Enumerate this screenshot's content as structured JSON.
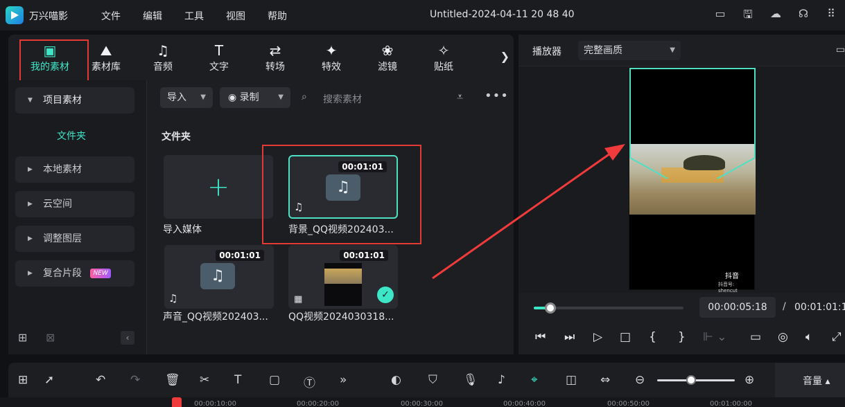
{
  "app": {
    "name": "万兴喵影",
    "doc_title": "Untitled-2024-04-11 20 48 40"
  },
  "menu": [
    "文件",
    "编辑",
    "工具",
    "视图",
    "帮助"
  ],
  "tabs": [
    {
      "label": "我的素材",
      "icon": "image-icon"
    },
    {
      "label": "素材库",
      "icon": "cloud-image-icon"
    },
    {
      "label": "音频",
      "icon": "music-note-icon"
    },
    {
      "label": "文字",
      "icon": "text-icon"
    },
    {
      "label": "转场",
      "icon": "transition-icon"
    },
    {
      "label": "特效",
      "icon": "sparkle-icon"
    },
    {
      "label": "滤镜",
      "icon": "filter-icon"
    },
    {
      "label": "贴纸",
      "icon": "sticker-icon"
    }
  ],
  "sidebar": {
    "project": "项目素材",
    "folder": "文件夹",
    "items": [
      "本地素材",
      "云空间",
      "调整图层",
      "复合片段"
    ],
    "new_badge": "NEW"
  },
  "toolbar": {
    "import": "导入",
    "record": "录制",
    "search_placeholder": "搜索素材"
  },
  "content": {
    "folder_title": "文件夹",
    "import_media": "导入媒体",
    "media": [
      {
        "label": "背景_QQ视频202403...",
        "duration": "00:01:01",
        "type": "audio"
      },
      {
        "label": "声音_QQ视频202403...",
        "duration": "00:01:01",
        "type": "audio"
      },
      {
        "label": "QQ视频2024030318...",
        "duration": "00:01:01",
        "type": "video"
      }
    ]
  },
  "player": {
    "label": "播放器",
    "quality": "完整画质",
    "current_time": "00:00:05:18",
    "separator": "/",
    "total_time": "00:01:01:1",
    "progress": 0.11,
    "watermark": "抖音",
    "watermark_sub": "抖音号: shencut"
  },
  "timeline": {
    "volume": "音量 ▴",
    "ruler": [
      "00:00:10:00",
      "00:00:20:00",
      "00:00:30:00",
      "00:00:40:00",
      "00:00:50:00",
      "00:01:00:00"
    ]
  },
  "colors": {
    "accent": "#3ee6c8",
    "highlight": "#e53935"
  }
}
